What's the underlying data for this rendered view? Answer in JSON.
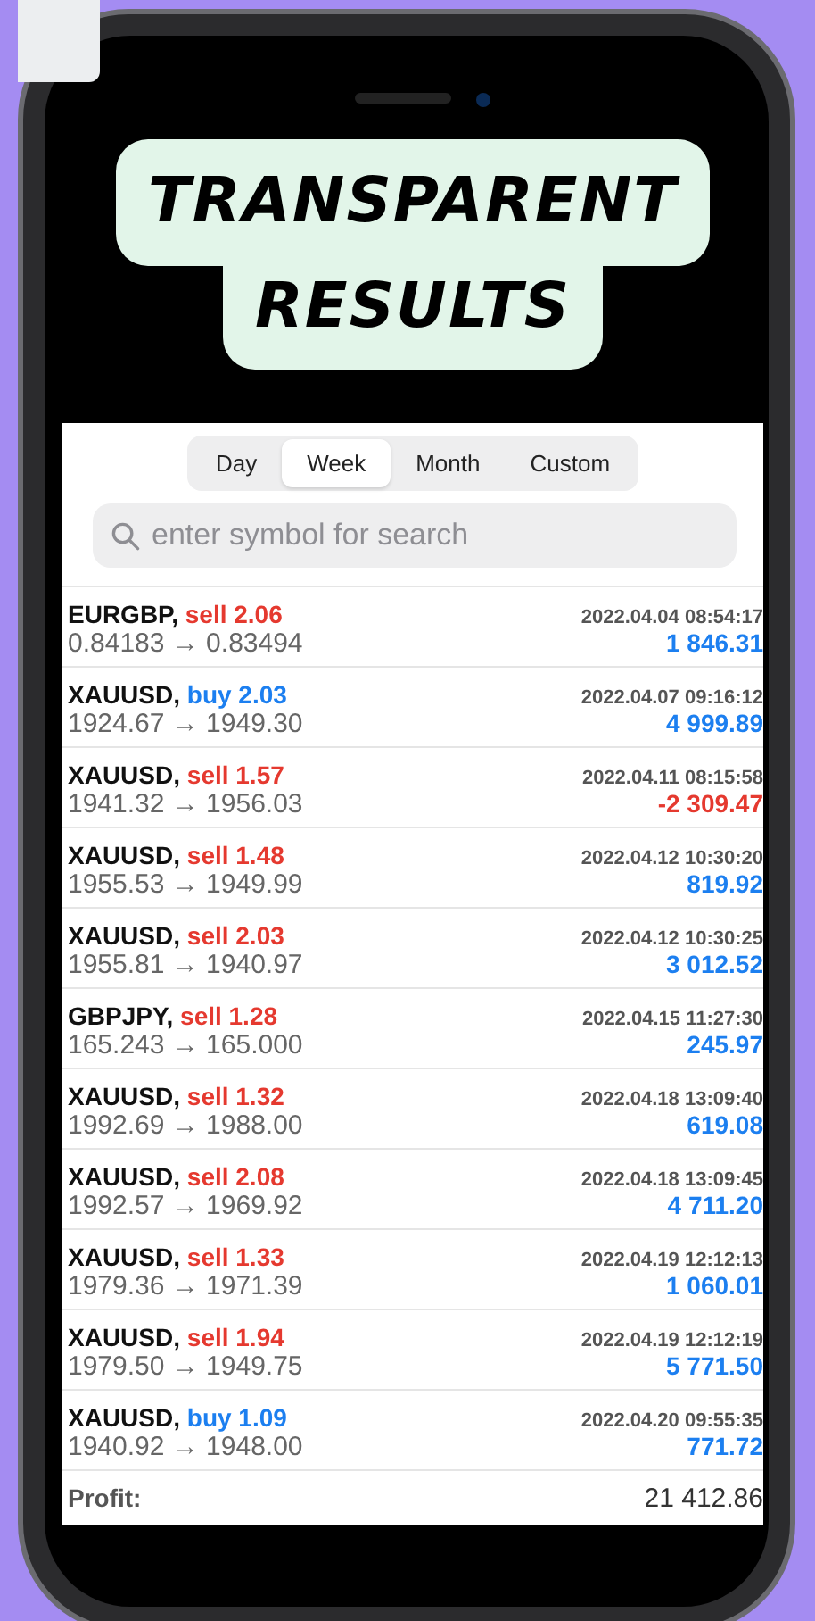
{
  "banner": {
    "lines": [
      "TRANSPARENT",
      "RESULTS"
    ]
  },
  "period_tabs": [
    {
      "label": "Day",
      "selected": false
    },
    {
      "label": "Week",
      "selected": true
    },
    {
      "label": "Month",
      "selected": false
    },
    {
      "label": "Custom",
      "selected": false
    }
  ],
  "search": {
    "placeholder": "enter symbol for search"
  },
  "trades": [
    {
      "symbol": "EURGBP,",
      "kind": "sell",
      "order": "sell 2.06",
      "prices": "0.84183 → 0.83494",
      "time": "2022.04.04 08:54:17",
      "profit": "1 846.31",
      "negative": false
    },
    {
      "symbol": "XAUUSD,",
      "kind": "buy",
      "order": "buy 2.03",
      "prices": "1924.67 → 1949.30",
      "time": "2022.04.07 09:16:12",
      "profit": "4 999.89",
      "negative": false
    },
    {
      "symbol": "XAUUSD,",
      "kind": "sell",
      "order": "sell 1.57",
      "prices": "1941.32 → 1956.03",
      "time": "2022.04.11 08:15:58",
      "profit": "-2 309.47",
      "negative": true
    },
    {
      "symbol": "XAUUSD,",
      "kind": "sell",
      "order": "sell 1.48",
      "prices": "1955.53 → 1949.99",
      "time": "2022.04.12 10:30:20",
      "profit": "819.92",
      "negative": false
    },
    {
      "symbol": "XAUUSD,",
      "kind": "sell",
      "order": "sell 2.03",
      "prices": "1955.81 → 1940.97",
      "time": "2022.04.12 10:30:25",
      "profit": "3 012.52",
      "negative": false
    },
    {
      "symbol": "GBPJPY,",
      "kind": "sell",
      "order": "sell 1.28",
      "prices": "165.243 → 165.000",
      "time": "2022.04.15 11:27:30",
      "profit": "245.97",
      "negative": false
    },
    {
      "symbol": "XAUUSD,",
      "kind": "sell",
      "order": "sell 1.32",
      "prices": "1992.69 → 1988.00",
      "time": "2022.04.18 13:09:40",
      "profit": "619.08",
      "negative": false
    },
    {
      "symbol": "XAUUSD,",
      "kind": "sell",
      "order": "sell 2.08",
      "prices": "1992.57 → 1969.92",
      "time": "2022.04.18 13:09:45",
      "profit": "4 711.20",
      "negative": false
    },
    {
      "symbol": "XAUUSD,",
      "kind": "sell",
      "order": "sell 1.33",
      "prices": "1979.36 → 1971.39",
      "time": "2022.04.19 12:12:13",
      "profit": "1 060.01",
      "negative": false
    },
    {
      "symbol": "XAUUSD,",
      "kind": "sell",
      "order": "sell 1.94",
      "prices": "1979.50 → 1949.75",
      "time": "2022.04.19 12:12:19",
      "profit": "5 771.50",
      "negative": false
    },
    {
      "symbol": "XAUUSD,",
      "kind": "buy",
      "order": "buy 1.09",
      "prices": "1940.92 → 1948.00",
      "time": "2022.04.20 09:55:35",
      "profit": "771.72",
      "negative": false
    }
  ],
  "summary": {
    "label": "Profit:",
    "value": "21 412.86"
  }
}
